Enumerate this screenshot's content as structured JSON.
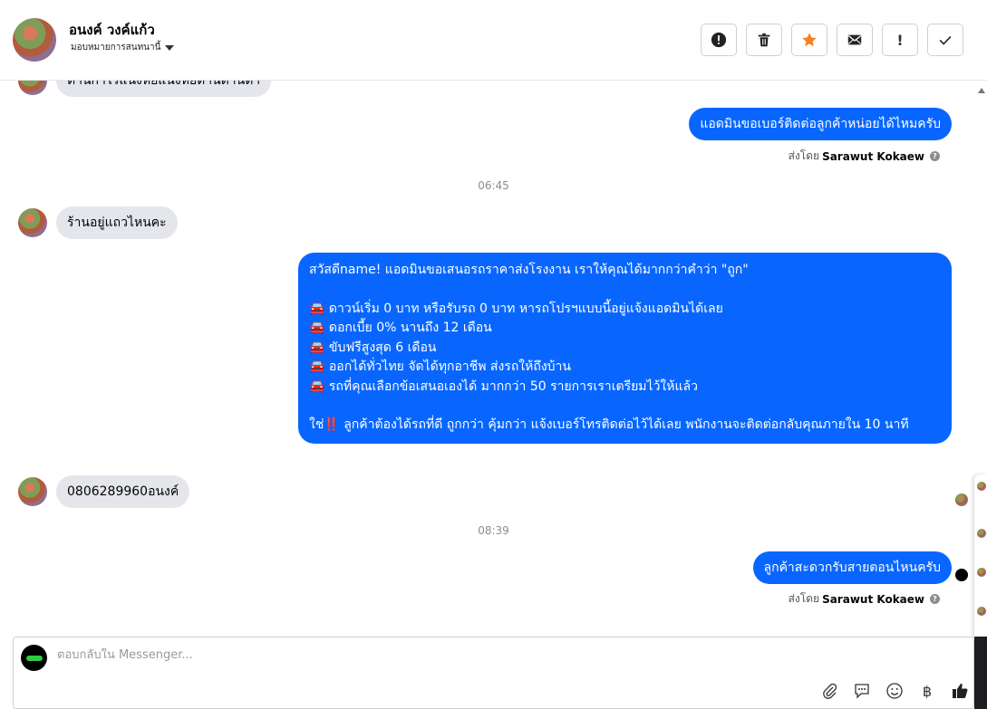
{
  "header": {
    "contact_name": "อนงค์ วงค์แก้ว",
    "assign_label": "มอบหมายการสนทนานี้",
    "actions": [
      {
        "name": "spam-button",
        "glyph": "!"
      },
      {
        "name": "delete-button",
        "glyph": ""
      },
      {
        "name": "star-button",
        "glyph": "★"
      },
      {
        "name": "mark-unread-button",
        "glyph": ""
      },
      {
        "name": "follow-up-button",
        "glyph": "!"
      },
      {
        "name": "done-button",
        "glyph": "✓"
      }
    ]
  },
  "messages": {
    "partial_in": "ต้านกำไรแน่งหั้ยแน่งหั้ยต้านต้านต้า",
    "out1": "แอดมินขอเบอร์ติดต่อลูกค้าหน่อยได้ไหมครับ",
    "sent_by_prefix": "ส่งโดย",
    "sender": "Sarawut Kokaew",
    "time1": "06:45",
    "in2": "ร้านอยู่แถวไหนคะ",
    "out2_line1": "สวัสดีname! แอดมินขอเสนอรถราคาส่งโรงงาน เราให้คุณได้มากกว่าคำว่า \"ถูก\"",
    "out2_bullets": [
      "ดาวน์เริ่ม 0 บาท หรือรับรถ 0 บาท หารถโปรฯแบบนี้อยู่แจ้งแอดมินได้เลย",
      "ดอกเบี้ย 0% นานถึง 12 เดือน",
      "ขับฟรีสูงสุด 6 เดือน",
      "ออกได้ทั่วไทย จัดได้ทุกอาชีพ ส่งรถให้ถึงบ้าน",
      "รถที่คุณเลือกข้อเสนอเองได้ มากกว่า 50 รายการเราเตรียมไว้ให้แล้ว"
    ],
    "out2_close": "ใช่‼️ ลูกค้าต้องได้รถที่ดี ถูกกว่า คุ้มกว่า แจ้งเบอร์โทรติดต่อไว้ได้เลย พนักงานจะติดต่อกลับคุณภายใน 10 นาที",
    "in3": "0806289960อนงค์",
    "time2": "08:39",
    "out3": "ลูกค้าสะดวกรับสายตอนไหนครับ"
  },
  "composer": {
    "placeholder": "ตอบกลับใน Messenger...",
    "baht": "฿"
  },
  "colors": {
    "outgoing_bubble": "#0866ff",
    "incoming_bubble": "#e4e6eb",
    "star": "#f5811f"
  }
}
